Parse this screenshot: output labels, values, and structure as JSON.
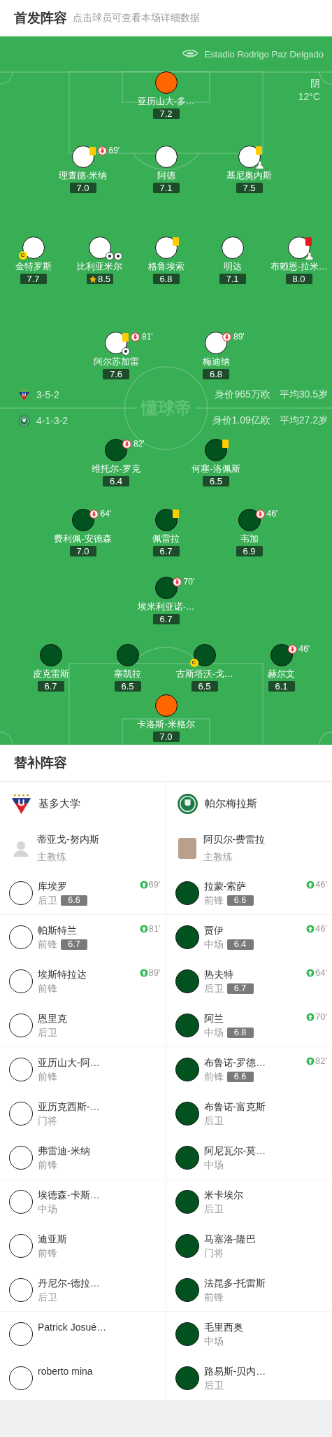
{
  "header": {
    "title": "首发阵容",
    "subtitle": "点击球员可查看本场详细数据"
  },
  "pitch": {
    "stadium": "Estadio Rodrigo Paz Delgado",
    "weather": "阴",
    "temperature": "12°C",
    "center_logo": "懂球帝",
    "teams": [
      {
        "crest": {
          "kind": "shield"
        },
        "formation": "3-5-2",
        "value": "身价965万欧",
        "avg_age": "平均30.5岁",
        "rows": [
          {
            "players": [
              {
                "name": "亚历山大-多…",
                "rating": "7.2",
                "mvp": false,
                "color": "#ff6600"
              }
            ]
          },
          {
            "players": [
              {
                "name": "理查德-米纳",
                "rating": "7.0",
                "mvp": false,
                "color": "#ffffff",
                "events": [
                  {
                    "kind": "yellow_card"
                  },
                  {
                    "kind": "sub_out",
                    "minute": "69'"
                  }
                ]
              },
              {
                "name": "阿德",
                "rating": "7.1",
                "mvp": false,
                "color": "#ffffff"
              },
              {
                "name": "基尼奥内斯",
                "rating": "7.5",
                "mvp": false,
                "color": "#ffffff",
                "events": [
                  {
                    "kind": "yellow_card"
                  },
                  {
                    "kind": "assist"
                  }
                ]
              }
            ]
          },
          {
            "players": [
              {
                "name": "金特罗斯",
                "rating": "7.7",
                "mvp": false,
                "color": "#ffffff",
                "events": [
                  {
                    "kind": "captain",
                    "label": "C"
                  }
                ]
              },
              {
                "name": "比利亚米尔",
                "rating": "8.5",
                "mvp": true,
                "color": "#ffffff",
                "events": [
                  {
                    "kind": "goal"
                  },
                  {
                    "kind": "goal"
                  }
                ]
              },
              {
                "name": "格鲁埃索",
                "rating": "6.8",
                "mvp": false,
                "color": "#ffffff",
                "events": [
                  {
                    "kind": "yellow_card"
                  }
                ]
              },
              {
                "name": "明达",
                "rating": "7.1",
                "mvp": false,
                "color": "#ffffff"
              },
              {
                "name": "布赖恩-拉米…",
                "rating": "8.0",
                "mvp": false,
                "color": "#ffffff",
                "events": [
                  {
                    "kind": "red_card"
                  },
                  {
                    "kind": "assist"
                  }
                ]
              }
            ]
          },
          {
            "players": [
              {
                "name": "阿尔苏加雷",
                "rating": "7.6",
                "mvp": false,
                "color": "#ffffff",
                "events": [
                  {
                    "kind": "yellow_card"
                  },
                  {
                    "kind": "sub_out",
                    "minute": "81'"
                  },
                  {
                    "kind": "goal"
                  }
                ]
              },
              {
                "name": "梅迪纳",
                "rating": "6.8",
                "mvp": false,
                "color": "#ffffff",
                "events": [
                  {
                    "kind": "sub_out",
                    "minute": "89'"
                  }
                ]
              }
            ]
          }
        ]
      },
      {
        "crest": {
          "kind": "round"
        },
        "formation": "4-1-3-2",
        "value": "身价1.09亿欧",
        "avg_age": "平均27.2岁",
        "rows": [
          {
            "players": [
              {
                "name": "维托尔-罗克",
                "rating": "6.4",
                "mvp": false,
                "color": "#01521f",
                "events": [
                  {
                    "kind": "sub_out",
                    "minute": "82'"
                  }
                ]
              },
              {
                "name": "何塞-洛佩斯",
                "rating": "6.5",
                "mvp": false,
                "color": "#01521f",
                "events": [
                  {
                    "kind": "yellow_card"
                  }
                ]
              }
            ]
          },
          {
            "players": [
              {
                "name": "费利佩-安德森",
                "rating": "7.0",
                "mvp": false,
                "color": "#01521f",
                "events": [
                  {
                    "kind": "sub_out",
                    "minute": "64'"
                  }
                ]
              },
              {
                "name": "佩雷拉",
                "rating": "6.7",
                "mvp": false,
                "color": "#01521f",
                "events": [
                  {
                    "kind": "yellow_card"
                  }
                ]
              },
              {
                "name": "韦加",
                "rating": "6.9",
                "mvp": false,
                "color": "#01521f",
                "events": [
                  {
                    "kind": "sub_out",
                    "minute": "46'"
                  }
                ]
              }
            ]
          },
          {
            "players": [
              {
                "name": "埃米利亚诺-…",
                "rating": "6.7",
                "mvp": false,
                "color": "#01521f",
                "events": [
                  {
                    "kind": "sub_out",
                    "minute": "70'"
                  }
                ]
              }
            ]
          },
          {
            "players": [
              {
                "name": "皮克雷斯",
                "rating": "6.7",
                "mvp": false,
                "color": "#01521f"
              },
              {
                "name": "塞凯拉",
                "rating": "6.5",
                "mvp": false,
                "color": "#01521f"
              },
              {
                "name": "古斯塔沃-戈…",
                "rating": "6.5",
                "mvp": false,
                "color": "#01521f",
                "events": [
                  {
                    "kind": "captain",
                    "label": "C"
                  }
                ]
              },
              {
                "name": "赫尔文",
                "rating": "6.1",
                "mvp": false,
                "color": "#01521f",
                "events": [
                  {
                    "kind": "sub_out",
                    "minute": "46'"
                  }
                ]
              }
            ]
          },
          {
            "players": [
              {
                "name": "卡洛斯-米格尔",
                "rating": "7.0",
                "mvp": false,
                "color": "#ff6600"
              }
            ]
          }
        ]
      }
    ]
  },
  "bench": {
    "title": "替补阵容",
    "teams": [
      {
        "name": "基多大学",
        "crest": {
          "kind": "shield"
        },
        "coach": {
          "name": "蒂亚戈-努内斯",
          "role": "主教练",
          "has_photo": false
        },
        "players": [
          {
            "name": "库埃罗",
            "position": "后卫",
            "rating": "6.6",
            "sub_in": "69'",
            "color": "#ffffff"
          },
          {
            "name": "帕斯特兰",
            "position": "前锋",
            "rating": "6.7",
            "sub_in": "81'",
            "color": "#ffffff"
          },
          {
            "name": "埃斯特拉达",
            "position": "前锋",
            "sub_in": "89'",
            "color": "#ffffff"
          },
          {
            "name": "恩里克",
            "position": "后卫",
            "color": "#ffffff"
          },
          {
            "name": "亚历山大-阿…",
            "position": "前锋",
            "color": "#ffffff"
          },
          {
            "name": "亚历克西斯-…",
            "position": "门将",
            "color": "#ffffff"
          },
          {
            "name": "弗雷迪-米纳",
            "position": "前锋",
            "color": "#ffffff"
          },
          {
            "name": "埃德森-卡斯…",
            "position": "中场",
            "color": "#ffffff"
          },
          {
            "name": "迪亚斯",
            "position": "前锋",
            "color": "#ffffff"
          },
          {
            "name": "丹尼尔-德拉…",
            "position": "后卫",
            "color": "#ffffff"
          },
          {
            "name": "Patrick Josué…",
            "color": "#ffffff"
          },
          {
            "name": "roberto mina",
            "color": "#ffffff"
          }
        ]
      },
      {
        "name": "帕尔梅拉斯",
        "crest": {
          "kind": "round"
        },
        "coach": {
          "name": "阿贝尔-费雷拉",
          "role": "主教练",
          "has_photo": true
        },
        "players": [
          {
            "name": "拉蒙-索萨",
            "position": "前锋",
            "rating": "6.6",
            "sub_in": "46'",
            "color": "#01521f"
          },
          {
            "name": "贾伊",
            "position": "中场",
            "rating": "6.4",
            "sub_in": "46'",
            "color": "#01521f"
          },
          {
            "name": "热夫特",
            "position": "后卫",
            "rating": "6.7",
            "sub_in": "64'",
            "color": "#01521f"
          },
          {
            "name": "阿兰",
            "position": "中场",
            "rating": "6.8",
            "sub_in": "70'",
            "color": "#01521f"
          },
          {
            "name": "布鲁诺-罗德…",
            "position": "前锋",
            "rating": "6.6",
            "sub_in": "82'",
            "color": "#01521f"
          },
          {
            "name": "布鲁诺-富克斯",
            "position": "后卫",
            "color": "#01521f"
          },
          {
            "name": "阿尼瓦尔-莫…",
            "position": "中场",
            "color": "#01521f"
          },
          {
            "name": "米卡埃尔",
            "position": "后卫",
            "color": "#01521f"
          },
          {
            "name": "马塞洛-隆巴",
            "position": "门将",
            "color": "#01521f"
          },
          {
            "name": "法昆多-托雷斯",
            "position": "前锋",
            "color": "#01521f"
          },
          {
            "name": "毛里西奥",
            "position": "中场",
            "color": "#01521f"
          },
          {
            "name": "路易斯-贝内…",
            "position": "后卫",
            "color": "#01521f"
          }
        ]
      }
    ]
  }
}
